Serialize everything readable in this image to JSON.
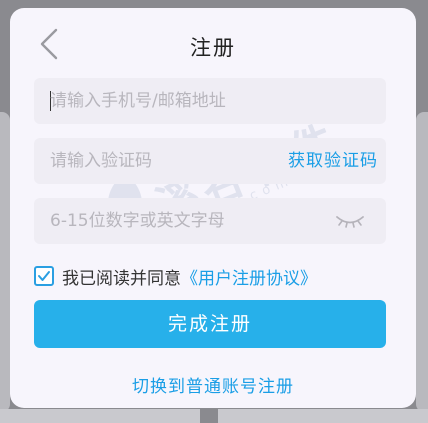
{
  "header": {
    "title": "注册",
    "back_icon": "chevron-left-icon"
  },
  "form": {
    "account_placeholder": "请输入手机号/邮箱地址",
    "account_value": "",
    "code_placeholder": "请输入验证码",
    "code_value": "",
    "get_code_label": "获取验证码",
    "password_placeholder": "6-15位数字或英文字母",
    "password_value": "",
    "eye_icon": "eye-closed-icon"
  },
  "agreement": {
    "checked": true,
    "text": "我已阅读并同意",
    "link": "《用户注册协议》"
  },
  "submit_label": "完成注册",
  "switch_label": "切换到普通账号注册",
  "watermark": {
    "text": "溪谷软件",
    "url": "xigusdk.com"
  },
  "colors": {
    "accent": "#1a9ee6",
    "button": "#27b0ea",
    "dialog_bg": "#f7f5fc",
    "field_bg": "#efedf4"
  }
}
